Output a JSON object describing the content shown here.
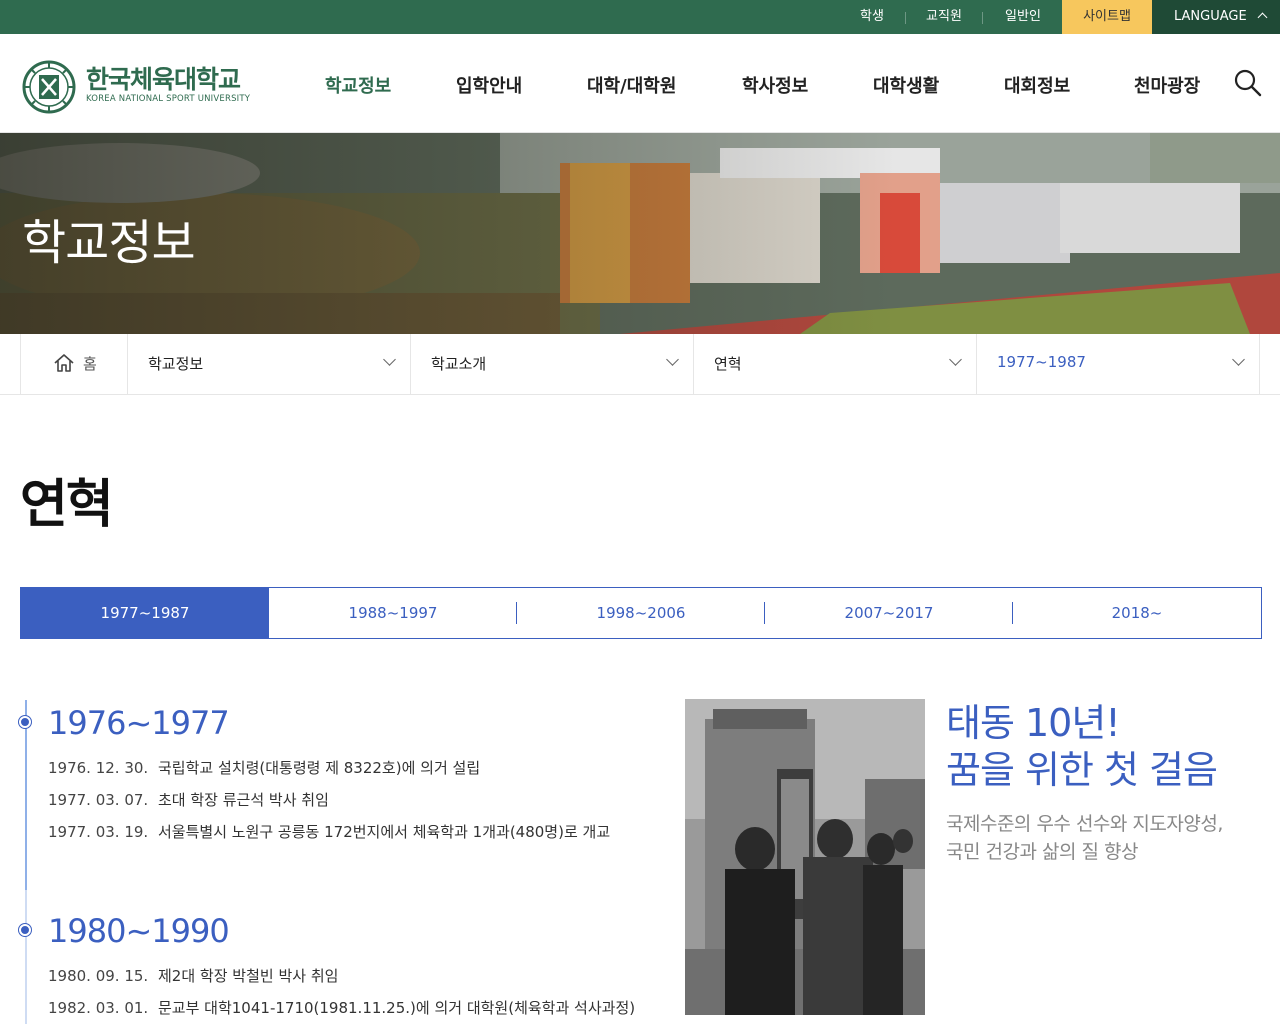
{
  "topbar": {
    "links": [
      "학생",
      "교직원",
      "일반인"
    ],
    "sitemap": "사이트맵",
    "language": "LANGUAGE"
  },
  "logo": {
    "name_ko": "한국체육대학교",
    "name_en": "KOREA NATIONAL SPORT UNIVERSITY"
  },
  "nav": {
    "items": [
      "학교정보",
      "입학안내",
      "대학/대학원",
      "학사정보",
      "대학생활",
      "대회정보",
      "천마광장"
    ],
    "active": "학교정보"
  },
  "hero": {
    "title": "학교정보"
  },
  "breadcrumb": {
    "home": "홈",
    "levels": [
      "학교정보",
      "학교소개",
      "연혁",
      "1977~1987"
    ]
  },
  "page_title": "연혁",
  "tabs": {
    "items": [
      "1977~1987",
      "1988~1997",
      "1998~2006",
      "2007~2017",
      "2018~"
    ],
    "active": "1977~1987"
  },
  "timeline": [
    {
      "period": "1976~1977",
      "events": [
        {
          "date": "1976. 12. 30.",
          "text": "국립학교 설치령(대통령령 제 8322호)에 의거 설립"
        },
        {
          "date": "1977. 03. 07.",
          "text": "초대 학장 류근석 박사 취임"
        },
        {
          "date": "1977. 03. 19.",
          "text": "서울특별시 노원구 공릉동 172번지에서 체육학과 1개과(480명)로 개교"
        }
      ]
    },
    {
      "period": "1980~1990",
      "events": [
        {
          "date": "1980. 09. 15.",
          "text": "제2대 학장 박철빈 박사 취임"
        },
        {
          "date": "1982. 03. 01.",
          "text": "문교부 대학1041-1710(1981.11.25.)에 의거 대학원(체육학과 석사과정)"
        }
      ]
    }
  ],
  "side": {
    "headline_1": "태동 10년!",
    "headline_2": "꿈을 위한 첫 걸음",
    "sub_1": "국제수준의 우수 선수와 지도자양성,",
    "sub_2": "국민 건강과 삶의 질 향상"
  },
  "colors": {
    "brand_green": "#2f6b4f",
    "accent_blue": "#3b5fc0",
    "sitemap_yellow": "#f7c75d"
  }
}
